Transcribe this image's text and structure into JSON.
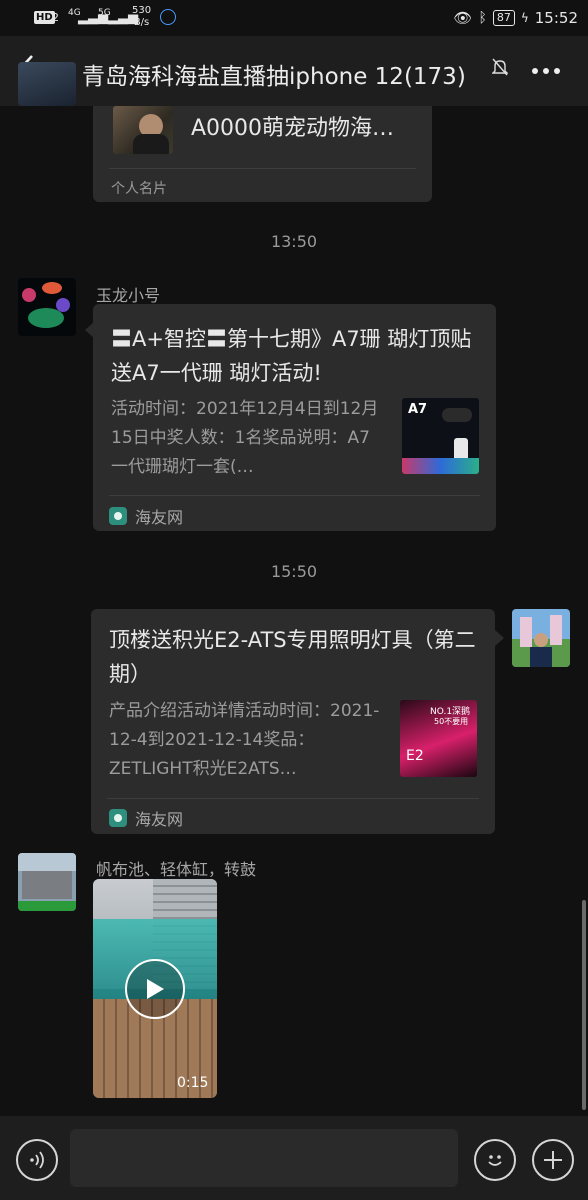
{
  "status_bar": {
    "hd": "HD",
    "sim1": "2",
    "net1": "4G",
    "net2": "5G",
    "speed_value": "530",
    "speed_unit": "B/s",
    "battery": "87",
    "time": "15:52"
  },
  "header": {
    "title": "青岛海科海盐直播抽iphone 12(173)"
  },
  "messages": {
    "contact_card": {
      "name": "A0000萌宠动物海…",
      "type_label": "个人名片"
    },
    "time_1": "13:50",
    "msg2": {
      "sender": "玉龙小号",
      "title": "〓A+智控〓第十七期》A7珊 瑚灯顶贴送A7一代珊 瑚灯活动!",
      "desc": "活动时间：2021年12月4日到12月15日中奖人数：1名奖品说明：A7一代珊瑚灯一套(…",
      "thumb_text": "A7",
      "source": "海友网"
    },
    "time_2": "15:50",
    "msg3": {
      "title": "顶楼送积光E2-ATS专用照明灯具（第二期）",
      "desc": "产品介绍活动详情活动时间：2021-12-4到2021-12-14奖品：ZETLIGHT积光E2ATS…",
      "thumb_text_1": "NO.1深鹅",
      "thumb_text_2": "50不要用",
      "thumb_text_3": "E2",
      "source": "海友网"
    },
    "msg4": {
      "sender": "帆布池、轻体缸，转鼓",
      "video_duration": "0:15"
    }
  },
  "colors": {
    "background": "#111111",
    "bar": "#1e1e1e",
    "bubble": "#2c2c2c",
    "accent_logo": "#2f8f7f"
  }
}
